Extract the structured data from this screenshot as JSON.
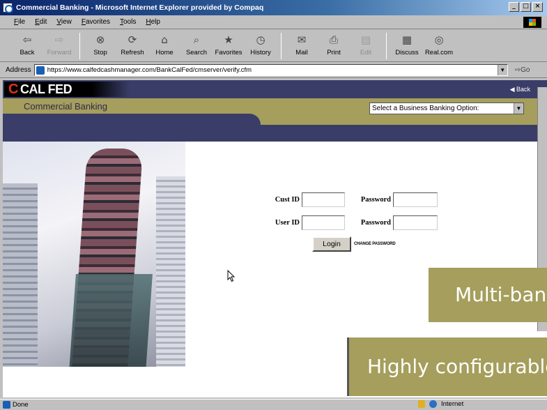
{
  "window": {
    "title": "Commercial Banking - Microsoft Internet Explorer provided by Compaq"
  },
  "menu": [
    "File",
    "Edit",
    "View",
    "Favorites",
    "Tools",
    "Help"
  ],
  "toolbar": [
    {
      "label": "Back",
      "icon": "back-arrow-icon",
      "glyph": "⇦",
      "enabled": true
    },
    {
      "label": "Forward",
      "icon": "forward-arrow-icon",
      "glyph": "⇨",
      "enabled": false
    },
    {
      "label": "Stop",
      "icon": "stop-icon",
      "glyph": "⊗",
      "enabled": true
    },
    {
      "label": "Refresh",
      "icon": "refresh-icon",
      "glyph": "⟳",
      "enabled": true
    },
    {
      "label": "Home",
      "icon": "home-icon",
      "glyph": "⌂",
      "enabled": true
    },
    {
      "label": "Search",
      "icon": "search-icon",
      "glyph": "⌕",
      "enabled": true
    },
    {
      "label": "Favorites",
      "icon": "favorites-icon",
      "glyph": "★",
      "enabled": true
    },
    {
      "label": "History",
      "icon": "history-icon",
      "glyph": "◷",
      "enabled": true
    },
    {
      "label": "Mail",
      "icon": "mail-icon",
      "glyph": "✉",
      "enabled": true
    },
    {
      "label": "Print",
      "icon": "print-icon",
      "glyph": "⎙",
      "enabled": true
    },
    {
      "label": "Edit",
      "icon": "edit-icon",
      "glyph": "▤",
      "enabled": false
    },
    {
      "label": "Discuss",
      "icon": "discuss-icon",
      "glyph": "▦",
      "enabled": true
    },
    {
      "label": "Real.com",
      "icon": "realcom-icon",
      "glyph": "◎",
      "enabled": true
    }
  ],
  "address": {
    "label": "Address",
    "url": "https://www.calfedcashmanager.com/BankCalFed/cmserver/verify.cfm",
    "go_label": "Go"
  },
  "site": {
    "logo_text": "CAL FED",
    "subtitle": "Commercial Banking",
    "back_link": "Back",
    "select_value": "Select a Business Banking Option:"
  },
  "login": {
    "cust_id_label": "Cust ID",
    "user_id_label": "User ID",
    "password_label": "Password",
    "button_label": "Login",
    "change_password": "CHANGE PASSWORD"
  },
  "callouts": {
    "multi": "Multi-bank",
    "configurable": "Highly configurable"
  },
  "status": {
    "text": "Done",
    "zone": "Internet"
  },
  "colors": {
    "brand_olive": "#a59e5c",
    "brand_navy": "#3a3d68",
    "logo_red": "#e03020"
  }
}
